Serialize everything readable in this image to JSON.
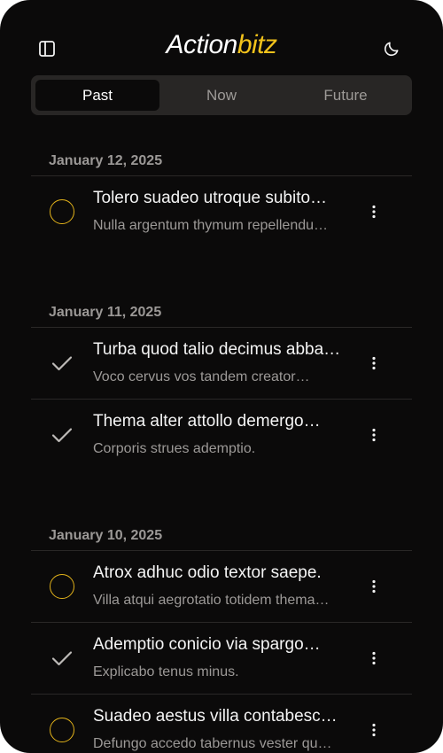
{
  "app": {
    "brand_part1": "Action",
    "brand_part2": "bitz"
  },
  "header": {
    "left_icon": "sidebar-panel-icon",
    "right_icon": "moon-icon"
  },
  "tabs": [
    {
      "label": "Past",
      "active": true
    },
    {
      "label": "Now",
      "active": false
    },
    {
      "label": "Future",
      "active": false
    }
  ],
  "groups": [
    {
      "date": "January 12, 2025",
      "items": [
        {
          "title": "Tolero suadeo utroque subito…",
          "subtitle": "Nulla argentum thymum repellendu…",
          "status": "open"
        }
      ]
    },
    {
      "date": "January 11, 2025",
      "items": [
        {
          "title": "Turba quod talio decimus abba…",
          "subtitle": "Voco cervus vos tandem creator…",
          "status": "done"
        },
        {
          "title": "Thema alter attollo demergo…",
          "subtitle": "Corporis strues ademptio.",
          "status": "done"
        }
      ]
    },
    {
      "date": "January 10, 2025",
      "items": [
        {
          "title": "Atrox adhuc odio textor saepe.",
          "subtitle": "Villa atqui aegrotatio totidem thema…",
          "status": "open"
        },
        {
          "title": "Ademptio conicio via spargo…",
          "subtitle": "Explicabo tenus minus.",
          "status": "done"
        },
        {
          "title": "Suadeo aestus villa contabesc…",
          "subtitle": "Defungo accedo tabernus vester qu…",
          "status": "open"
        }
      ]
    }
  ],
  "colors": {
    "background": "#0b0a0a",
    "accent": "#f2c21b",
    "tab_bar": "#282625",
    "muted_text": "#9c9997"
  }
}
